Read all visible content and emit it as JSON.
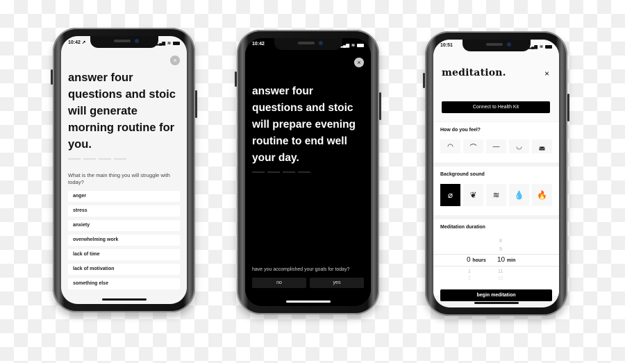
{
  "phones": [
    {
      "status_time": "10:42 ➚",
      "close_icon": "×",
      "headline": "answer four questions and stoic will generate morning routine for you.",
      "question": "What is the main thing you will struggle with today?",
      "options": [
        "anger",
        "stress",
        "anxiety",
        "overwhelming work",
        "lack of time",
        "lack of motivation",
        "something else"
      ]
    },
    {
      "status_time": "10:42",
      "close_icon": "×",
      "headline": "answer four questions and stoic will prepare evening routine to end well your day.",
      "question": "have you accomplished your goals for today?",
      "answers": [
        "no",
        "yes"
      ]
    },
    {
      "status_time": "10:51",
      "title": "meditation.",
      "close_icon": "×",
      "health_button": "Connect to Health Kit",
      "feel_label": "How do you feel?",
      "feel_options": [
        "◠",
        "⌒",
        "—",
        "◡",
        "◛"
      ],
      "sound_label": "Background sound",
      "sound_options": [
        "⌀",
        "❦",
        "≋",
        "💧",
        "🔥"
      ],
      "duration_label": "Meditation duration",
      "picker": {
        "minutes_above": [
          "8",
          "9"
        ],
        "hours_selected": "0",
        "hours_unit": "hours",
        "minutes_selected": "10",
        "minutes_unit": "min",
        "hours_below": [
          "1",
          "2"
        ],
        "minutes_below": [
          "11",
          "12"
        ]
      },
      "begin_button": "begin meditation"
    }
  ],
  "status_icons": {
    "signal": "▂▄▆",
    "wifi": "≋"
  }
}
